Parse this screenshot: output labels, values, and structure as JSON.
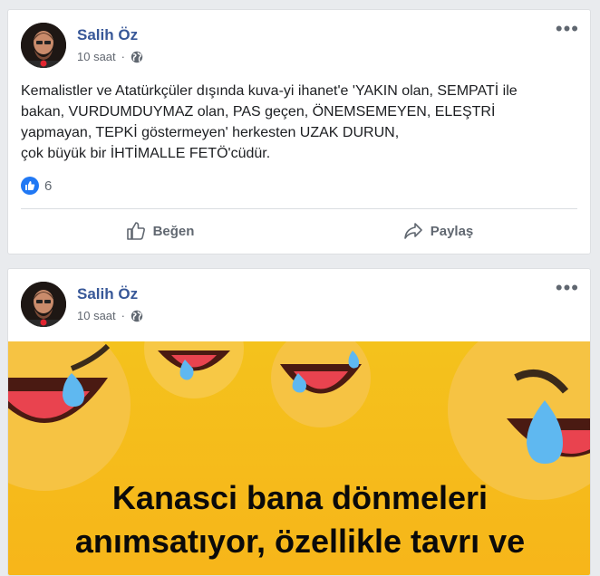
{
  "posts": [
    {
      "author": "Salih Öz",
      "time": "10 saat",
      "separator": "·",
      "more": "•••",
      "text_lines": [
        "Kemalistler ve Atatürkçüler dışında kuva-yi ihanet'e 'YAKIN olan, SEMPATİ ile",
        "bakan, VURDUMDUYMAZ olan, PAS geçen, ÖNEMSEMEYEN, ELEŞTRİ",
        "yapmayan, TEPKİ göstermeyen' herkesten UZAK DURUN,",
        "çok büyük bir İHTİMALLE FETÖ'cüdür."
      ],
      "like_count": "6",
      "actions": {
        "like": "Beğen",
        "share": "Paylaş"
      }
    },
    {
      "author": "Salih Öz",
      "time": "10 saat",
      "separator": "·",
      "more": "•••",
      "image_caption_lines": [
        "Kanasci bana dönmeleri",
        "anımsatıyor, özellikle tavrı ve"
      ]
    }
  ],
  "colors": {
    "author": "#385898",
    "like_blue": "#2078f4",
    "image_bg": "#f4c21c"
  },
  "icons": [
    "globe-icon",
    "more-icon",
    "like-icon",
    "thumbs-up-icon",
    "share-icon"
  ]
}
